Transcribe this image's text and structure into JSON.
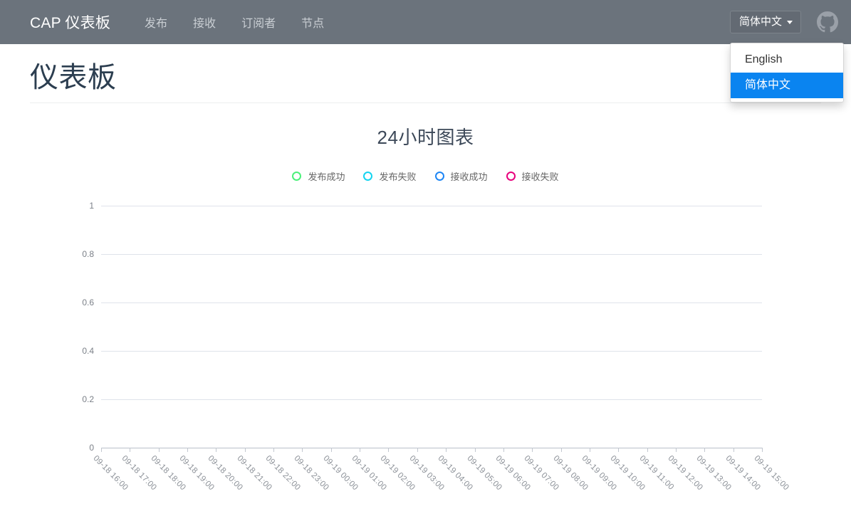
{
  "navbar": {
    "brand": "CAP 仪表板",
    "links": [
      {
        "label": "发布",
        "name": "nav-link-published"
      },
      {
        "label": "接收",
        "name": "nav-link-received"
      },
      {
        "label": "订阅者",
        "name": "nav-link-subscribers"
      },
      {
        "label": "节点",
        "name": "nav-link-nodes"
      }
    ],
    "language": {
      "selected": "简体中文",
      "options": [
        {
          "label": "English",
          "active": false
        },
        {
          "label": "简体中文",
          "active": true
        }
      ]
    },
    "github_icon": "github-icon",
    "colors": {
      "navbar_bg": "#6b737c",
      "brand_text": "#ffffff",
      "link_text": "#c9ced3",
      "dropdown_highlight": "#0a84f0"
    }
  },
  "page": {
    "title": "仪表板"
  },
  "chart_data": {
    "type": "line",
    "title": "24小时图表",
    "xlabel": "",
    "ylabel": "",
    "ylim": [
      0,
      1
    ],
    "yticks": [
      "0",
      "0.2",
      "0.4",
      "0.6",
      "0.8",
      "1"
    ],
    "grid": true,
    "legend_position": "top",
    "x": [
      "09-18 16:00",
      "09-18 17:00",
      "09-18 18:00",
      "09-18 19:00",
      "09-18 20:00",
      "09-18 21:00",
      "09-18 22:00",
      "09-18 23:00",
      "09-19 00:00",
      "09-19 01:00",
      "09-19 02:00",
      "09-19 03:00",
      "09-19 04:00",
      "09-19 05:00",
      "09-19 06:00",
      "09-19 07:00",
      "09-19 08:00",
      "09-19 09:00",
      "09-19 10:00",
      "09-19 11:00",
      "09-19 12:00",
      "09-19 13:00",
      "09-19 14:00",
      "09-19 15:00"
    ],
    "series": [
      {
        "name": "发布成功",
        "color": "#4cf07a",
        "values": [
          0,
          0,
          0,
          0,
          0,
          0,
          0,
          0,
          0,
          0,
          0,
          0,
          0,
          0,
          0,
          0,
          0,
          0,
          0,
          0,
          0,
          0,
          0,
          0
        ]
      },
      {
        "name": "发布失败",
        "color": "#14d4f0",
        "values": [
          0,
          0,
          0,
          0,
          0,
          0,
          0,
          0,
          0,
          0,
          0,
          0,
          0,
          0,
          0,
          0,
          0,
          0,
          0,
          0,
          0,
          0,
          0,
          0
        ]
      },
      {
        "name": "接收成功",
        "color": "#1e86f5",
        "values": [
          0,
          0,
          0,
          0,
          0,
          0,
          0,
          0,
          0,
          0,
          0,
          0,
          0,
          0,
          0,
          0,
          0,
          0,
          0,
          0,
          0,
          0,
          0,
          0
        ]
      },
      {
        "name": "接收失败",
        "color": "#e8007d",
        "values": [
          0,
          0,
          0,
          0,
          0,
          0,
          0,
          0,
          0,
          0,
          0,
          0,
          0,
          0,
          0,
          0,
          0,
          0,
          0,
          0,
          0,
          0,
          0,
          0
        ]
      }
    ]
  }
}
